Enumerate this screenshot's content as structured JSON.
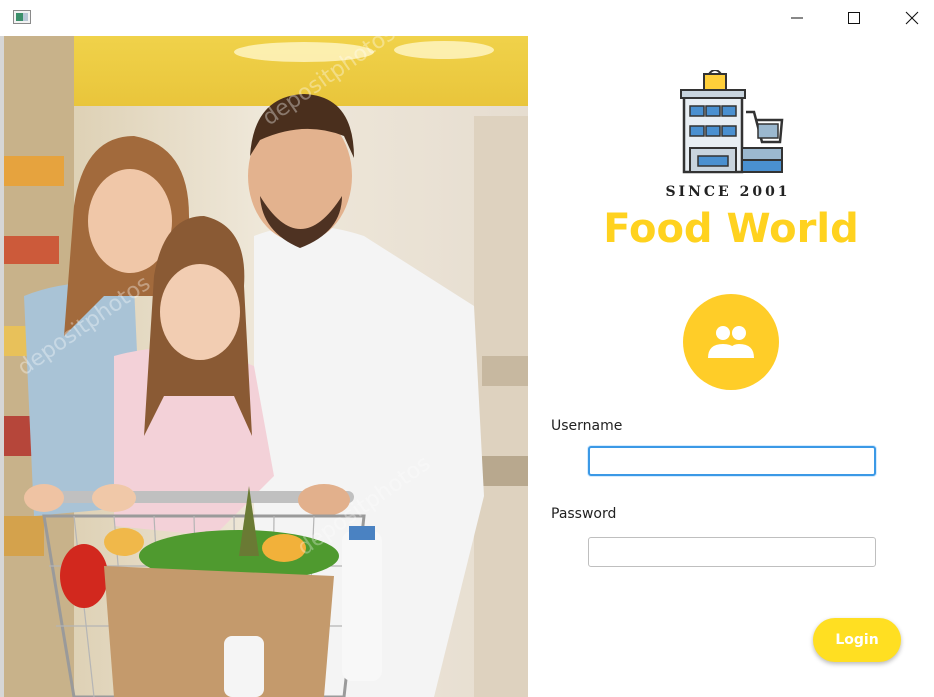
{
  "window": {
    "minimize_icon": "minimize-icon",
    "maximize_icon": "maximize-icon",
    "close_icon": "close-icon"
  },
  "photo": {
    "subject": "family-shopping-photo",
    "watermark": "depositphotos"
  },
  "brand": {
    "logo_icon": "store-with-cart-icon",
    "since": "SINCE 2001",
    "name": "Food World",
    "accent_color": "#ffd21f"
  },
  "login": {
    "avatar_icon": "users-icon",
    "username_label": "Username",
    "username_value": "",
    "password_label": "Password",
    "password_value": "",
    "button_label": "Login",
    "button_color": "#ffdf22",
    "focus_color": "#3b99e6"
  }
}
